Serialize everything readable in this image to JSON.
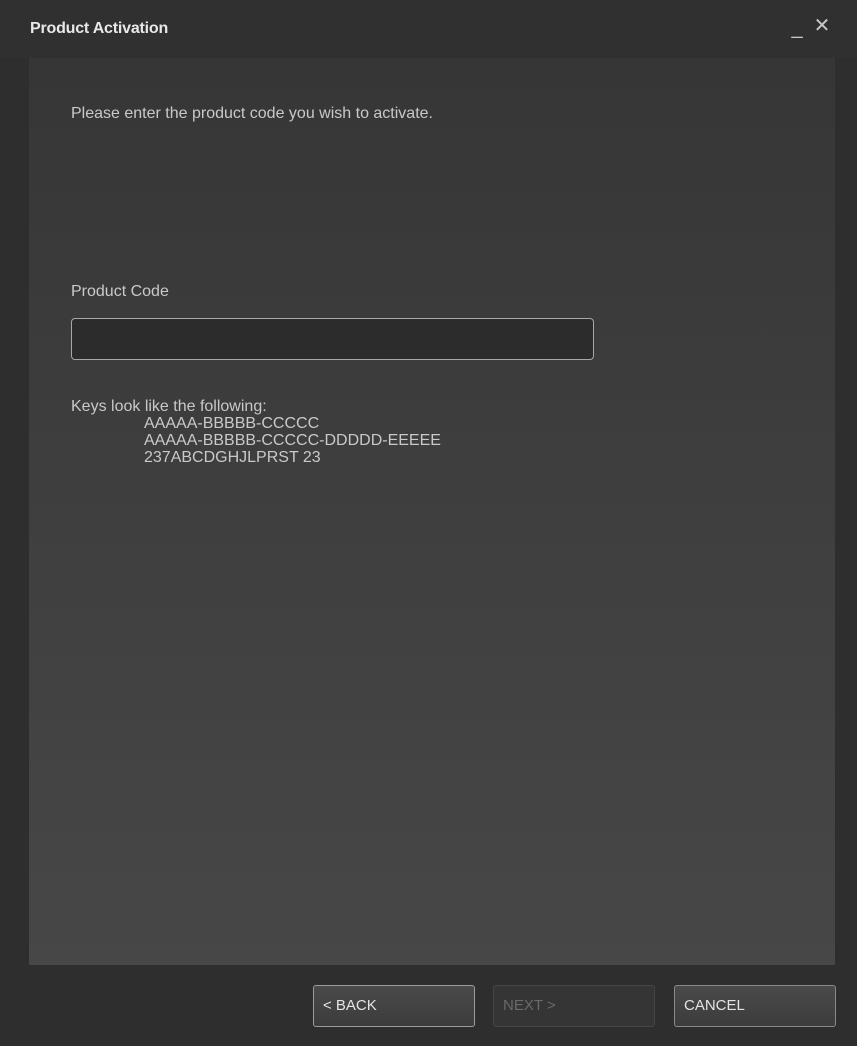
{
  "window": {
    "title": "Product Activation",
    "minimize_glyph": "_",
    "close_glyph": "✕"
  },
  "content": {
    "instruction": "Please enter the product code you wish to activate.",
    "field_label": "Product Code",
    "product_code_value": "",
    "product_code_placeholder": "",
    "hint_heading": "Keys look like the following:",
    "hint_examples": [
      "AAAAA-BBBBB-CCCCC",
      "AAAAA-BBBBB-CCCCC-DDDDD-EEEEE",
      "237ABCDGHJLPRST 23"
    ]
  },
  "footer": {
    "back_label": "< BACK",
    "next_label": "NEXT >",
    "cancel_label": "CANCEL",
    "next_enabled": false
  },
  "colors": {
    "background": "#2e2e2e",
    "panel_top": "#363636",
    "panel_bottom": "#474747",
    "text": "#c9c9c9",
    "disabled_text": "#6a6a6a"
  }
}
